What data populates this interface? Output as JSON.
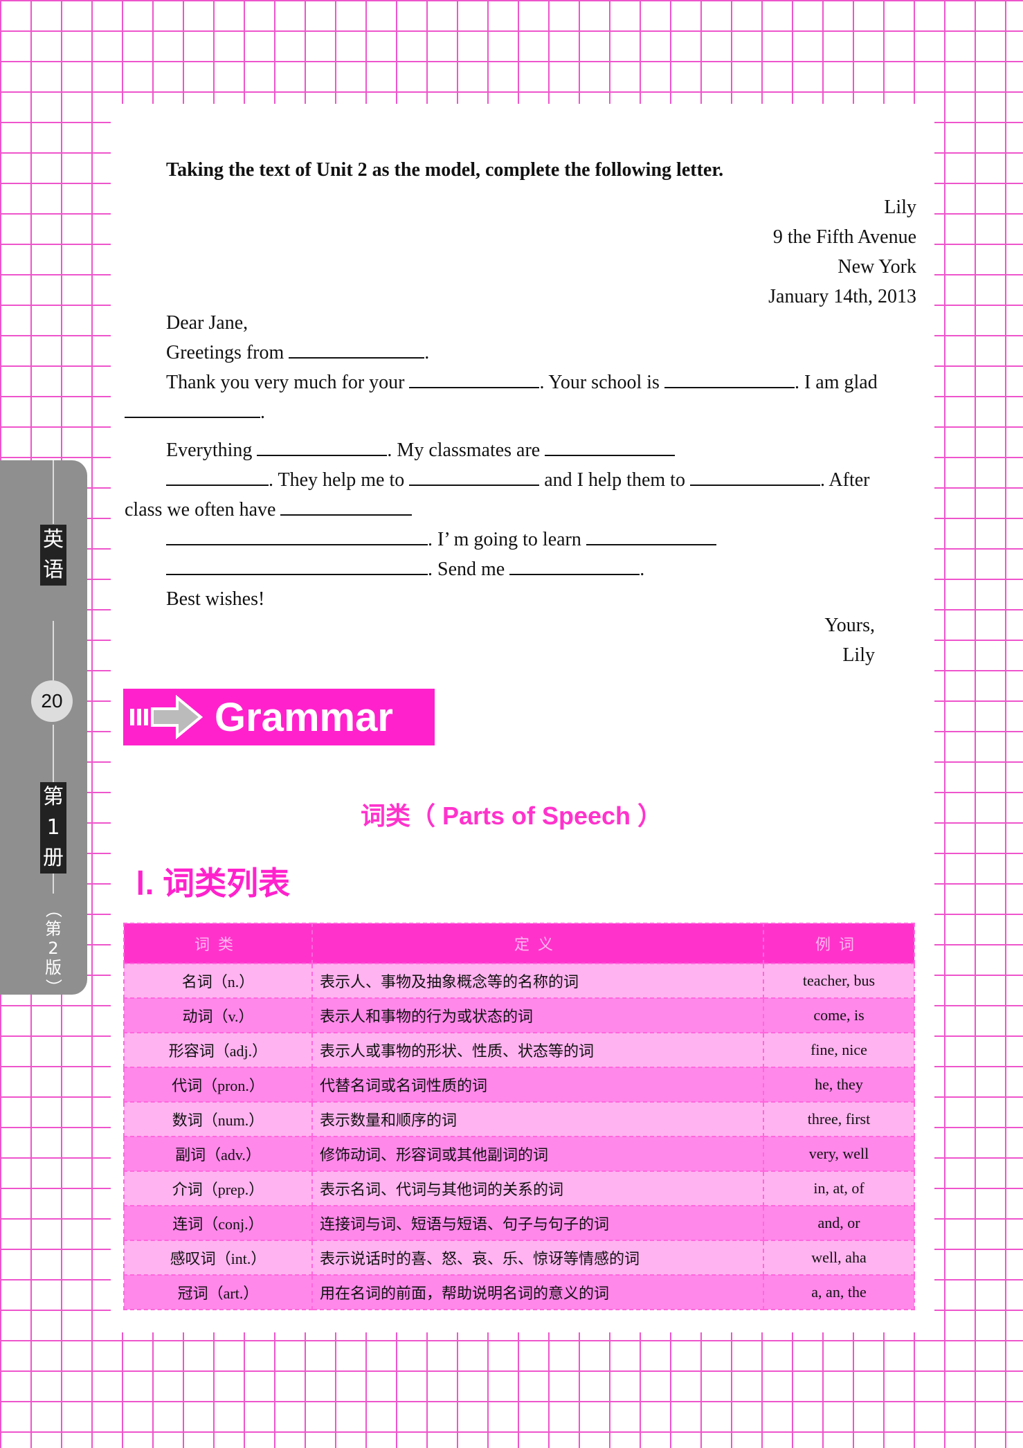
{
  "instruction": "Taking the text of Unit 2 as the model, complete the following letter.",
  "address": [
    "Lily",
    "9 the Fifth Avenue",
    "New York",
    "January 14th, 2013"
  ],
  "letter": {
    "salutation": "Dear Jane,",
    "l1": "Greetings from",
    "l2a": "Thank you very much for your",
    "l2b": ". Your school is",
    "l2c": ". I am glad",
    "l3": ".",
    "l4a": "Everything",
    "l4b": ". My classmates are",
    "l5a": ". They help me to",
    "l5b": "and I help them to",
    "l5c": ". After",
    "l6": "class we often have",
    "l7": ". I’ m going to learn",
    "l8": ". Send me",
    "l8b": ".",
    "closing": "Best wishes!",
    "sign1": "Yours,",
    "sign2": "Lily"
  },
  "grammar": {
    "banner": "Grammar",
    "pos_title": "词类（ Parts of Speech ）",
    "section": "Ⅰ.  词类列表"
  },
  "table": {
    "headers": [
      "词类",
      "定义",
      "例词"
    ],
    "rows": [
      [
        "名词（n.）",
        "表示人、事物及抽象概念等的名称的词",
        "teacher, bus"
      ],
      [
        "动词（v.）",
        "表示人和事物的行为或状态的词",
        "come, is"
      ],
      [
        "形容词（adj.）",
        "表示人或事物的形状、性质、状态等的词",
        "fine, nice"
      ],
      [
        "代词（pron.）",
        "代替名词或名词性质的词",
        "he, they"
      ],
      [
        "数词（num.）",
        "表示数量和顺序的词",
        "three, first"
      ],
      [
        "副词（adv.）",
        "修饰动词、形容词或其他副词的词",
        "very, well"
      ],
      [
        "介词（prep.）",
        "表示名词、代词与其他词的关系的词",
        "in, at, of"
      ],
      [
        "连词（conj.）",
        "连接词与词、短语与短语、句子与句子的词",
        "and, or"
      ],
      [
        "感叹词（int.）",
        "表示说话时的喜、怒、哀、乐、惊讶等情感的词",
        "well, aha"
      ],
      [
        "冠词（art.）",
        "用在名词的前面，帮助说明名词的意义的词",
        "a, an, the"
      ]
    ]
  },
  "sidebar": {
    "subject": [
      "英",
      "语"
    ],
    "page": "20",
    "volume": [
      "第",
      "1",
      "册"
    ],
    "edition": [
      "（",
      "第",
      "2",
      "版",
      "）"
    ]
  }
}
